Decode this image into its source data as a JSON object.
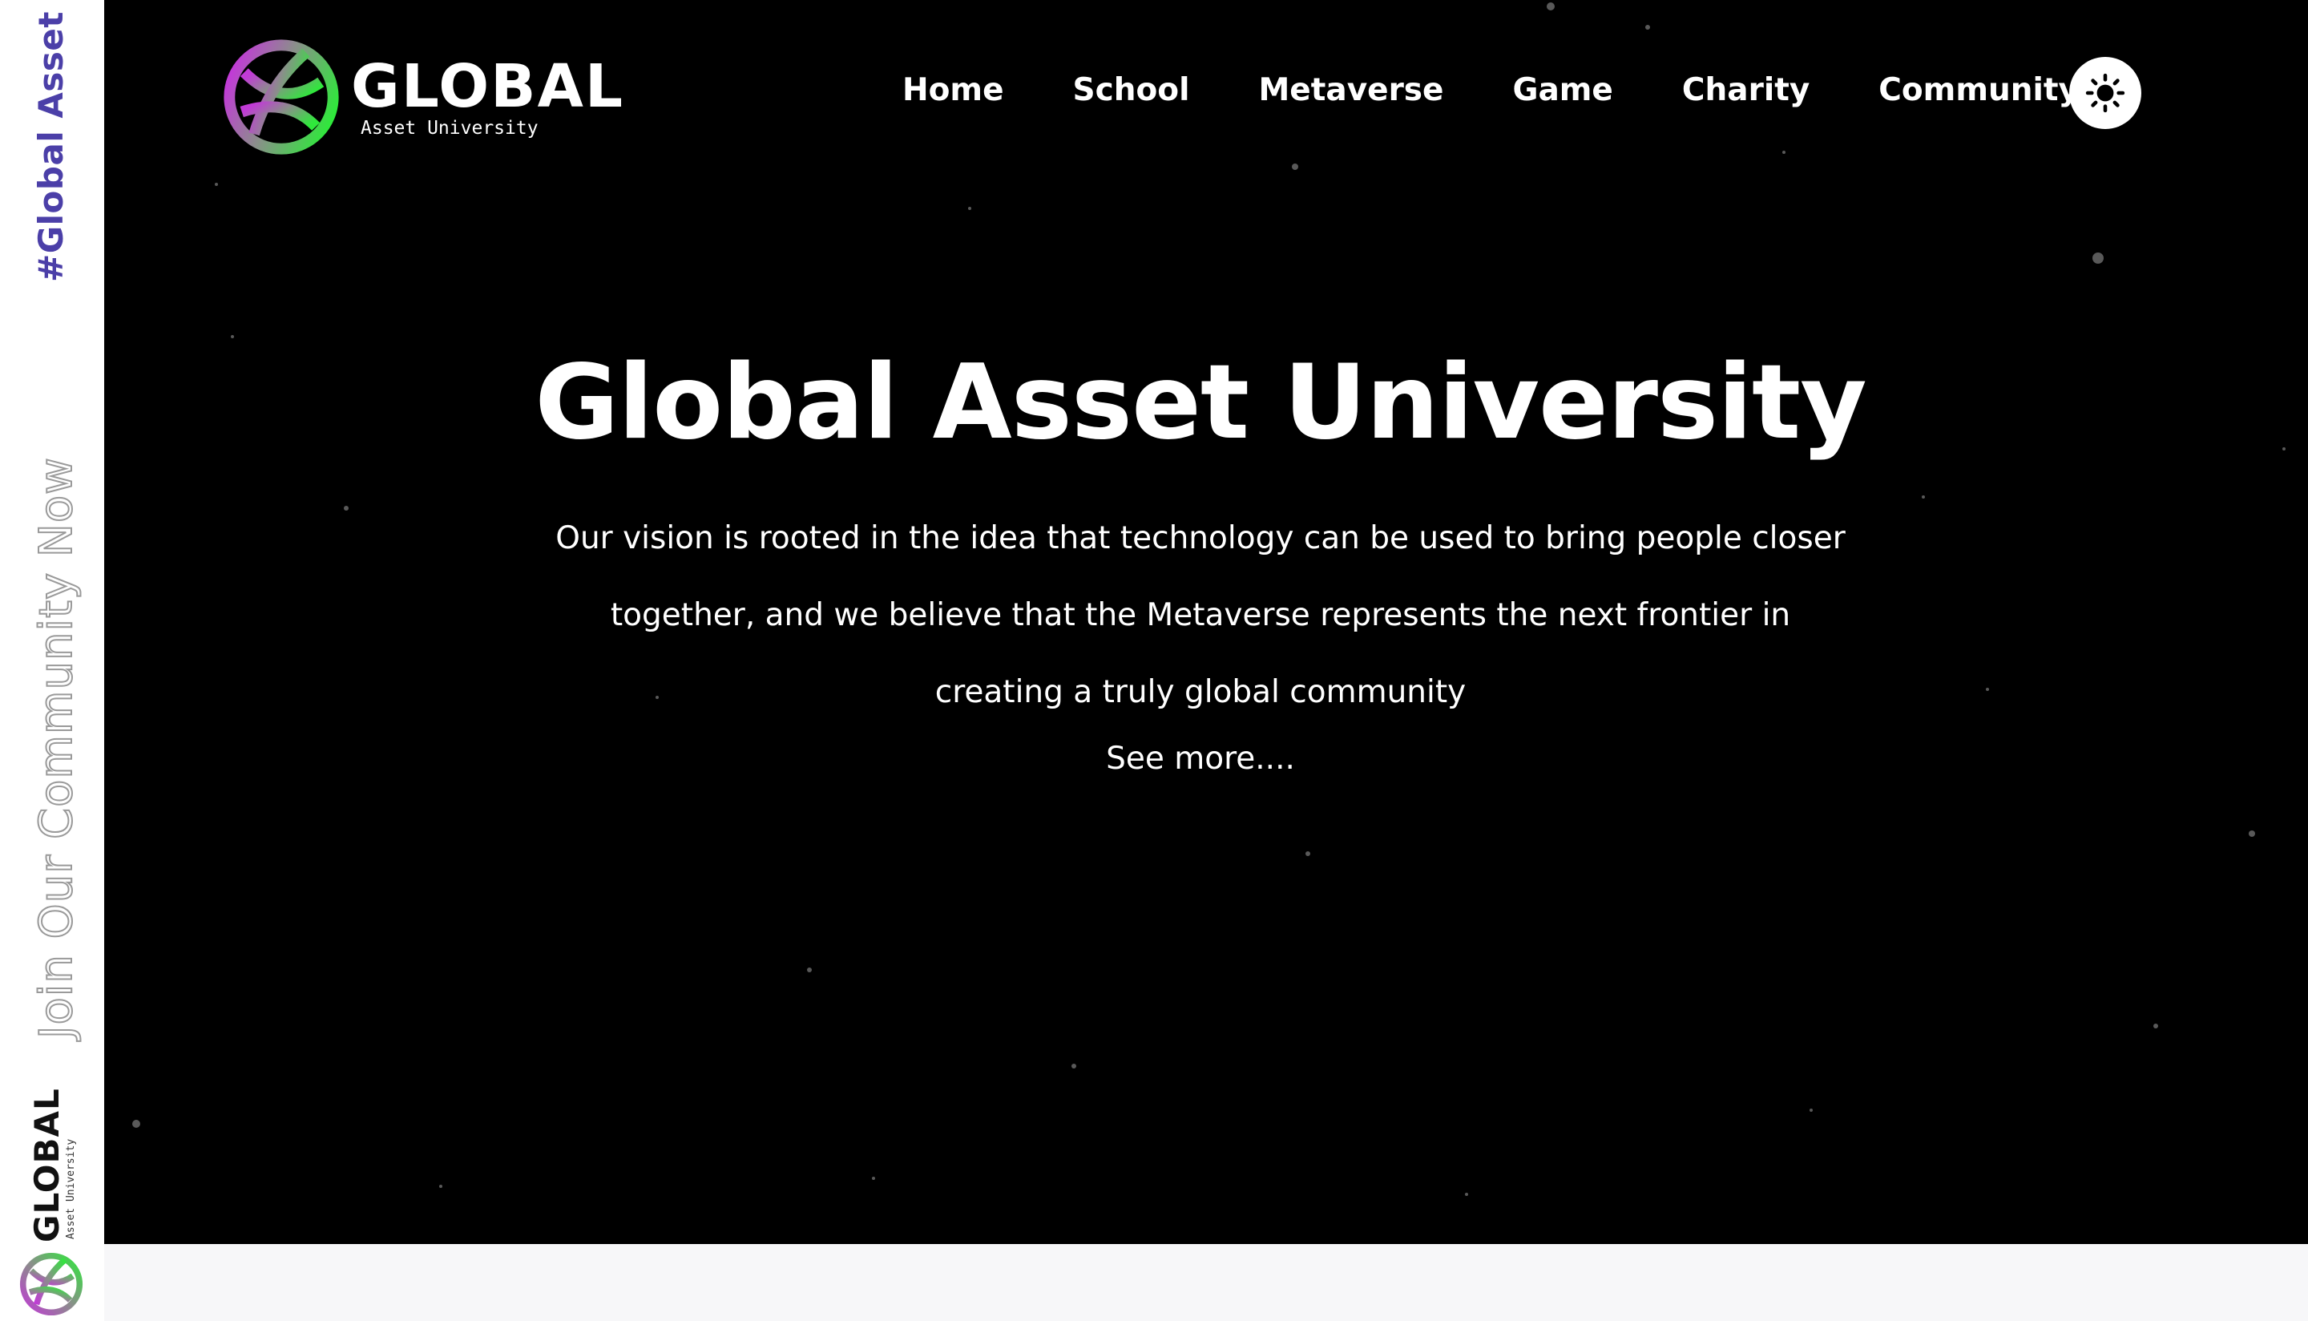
{
  "rail": {
    "hashtag": "#Global Asset U",
    "join": "Join Our Community Now",
    "logo_word": "GLOBAL",
    "logo_sub": "Asset University"
  },
  "header": {
    "logo_word": "GLOBAL",
    "logo_sub": "Asset University",
    "nav": [
      "Home",
      "School",
      "Metaverse",
      "Game",
      "Charity",
      "Community"
    ],
    "theme_toggle_icon": "sun-icon"
  },
  "hero": {
    "title": "Global Asset University",
    "description": "Our vision is rooted in the idea that technology can be used to bring people closer together, and we believe that the Metaverse represents the next frontier in creating a truly global community",
    "see_more": "See more...."
  },
  "colors": {
    "hero_bg": "#000000",
    "rail_bg": "#ffffff",
    "hashtag": "#4b3fa8",
    "globe_purple": "#b03ad8",
    "globe_green": "#2ee83a",
    "page_bg": "#f7f7f9"
  }
}
